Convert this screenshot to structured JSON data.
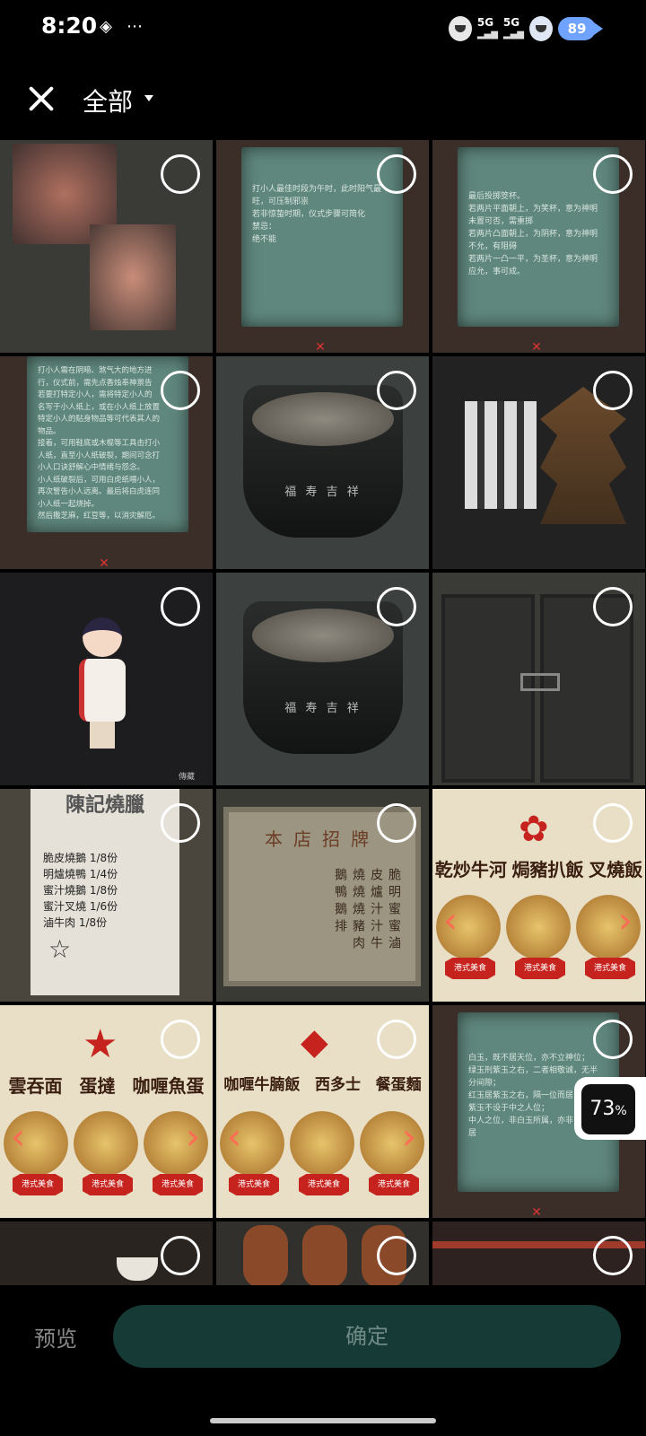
{
  "status_bar": {
    "time": "8:20",
    "signal_1": "5G",
    "signal_2": "5G",
    "battery": "89",
    "icons": [
      "layers-icon",
      "more-dots-icon",
      "emoji-icon",
      "wifi-icon",
      "cloud-icon",
      "battery-icon"
    ]
  },
  "header": {
    "album_title": "全部"
  },
  "tiles": {
    "t2_text": "打小人最佳时段为午时，此时阳气最\n旺，可压制邪祟\n若非惊蛰时期，仪式步骤可简化\n禁忌：\n绝不能",
    "t3_text": "最后投掷筊杯。\n若两片平面朝上，为笑杯，意为神明\n未置可否，需重掷\n若两片凸面朝上，为阴杯，意为神明\n不允，有阻碍\n若两片一凸一平，为圣杯，意为神明\n应允，事可成。",
    "t4_text": "打小人需在阴暗、煞气大的地方进\n行，仪式前，需先点香烛奉神禀告\n若要打特定小人，需将特定小人的\n名写于小人纸上，或在小人纸上放置\n特定小人的贴身物品等可代表其人的\n物品。\n接着，可用鞋底或木棍等工具击打小\n人纸，直至小人纸破裂，期间可念打\n小人口诀舒解心中情绪与怨念。\n小人纸破裂后，可用白虎纸喂小人，\n再次警告小人远离。最后将白虎连同\n小人纸一起烧掉。\n然后撒芝麻，红豆等，以消灾解厄。",
    "pot_text": "福 寿 吉 祥",
    "t7_watermark": "傳藏",
    "receipt_title": "陳記燒臘",
    "receipt_lines": "脆皮燒鵝 1/8份\n明爐燒鴨 1/4份\n蜜汁燒鵝 1/8份\n蜜汁叉燒 1/6份\n滷牛肉 1/8份",
    "sign_title": "本店招牌",
    "sign_items": [
      "脆皮燒鵝",
      "明爐燒鴨",
      "蜜汁燒鵝",
      "蜜汁豬排",
      "滷牛肉"
    ],
    "menu1": [
      "乾炒牛河",
      "焗豬扒飯",
      "叉燒飯"
    ],
    "menu2": [
      "雲吞面",
      "蛋撻",
      "咖喱魚蛋"
    ],
    "menu3": [
      "咖喱牛腩飯",
      "西多士",
      "餐蛋麵"
    ],
    "badge_label": "港式美食",
    "t15_text": "白玉，既不居天位，亦不立神位；\n绿玉刑紫玉之右，二者相敬诚，无半\n分间隙；\n红玉居紫玉之右，隔一位而居；\n紫玉不设于中之人位；\n中人之位，非白玉所属，亦非\n居"
  },
  "floating": {
    "percent": "73",
    "percent_unit": "%"
  },
  "footer": {
    "preview_label": "预览",
    "confirm_label": "确定"
  },
  "colors": {
    "confirm_bg": "#163a35",
    "confirm_text": "#6f8a86",
    "paper": "#5f877d",
    "battery": "#6fa3ff"
  }
}
